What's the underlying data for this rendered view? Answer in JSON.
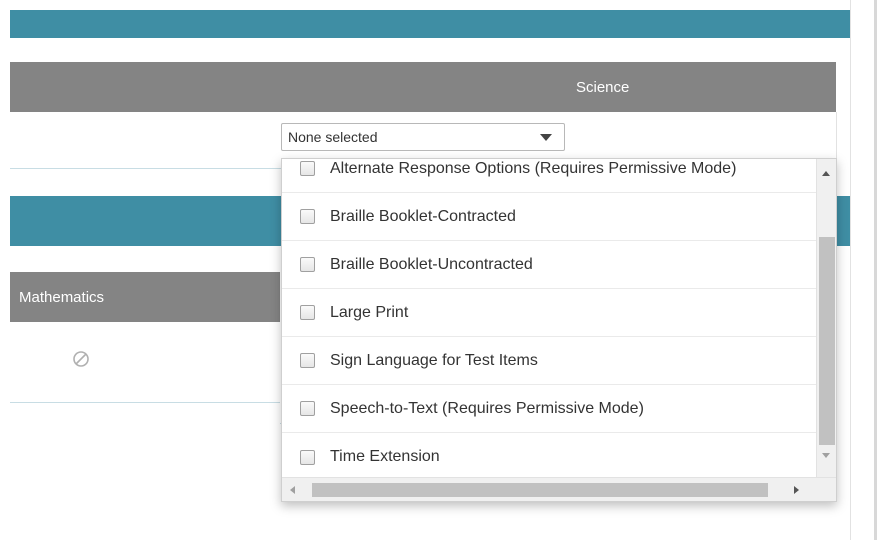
{
  "science": {
    "header": "Science",
    "select_value": "None selected"
  },
  "mathematics": {
    "header": "Mathematics",
    "cell_icon": "not-available-icon"
  },
  "dropdown": {
    "options": [
      "Alternate Response Options (Requires Permissive Mode)",
      "Braille Booklet-Contracted",
      "Braille Booklet-Uncontracted",
      "Large Print",
      "Sign Language for Test Items",
      "Speech-to-Text (Requires Permissive Mode)",
      "Time Extension"
    ]
  },
  "colors": {
    "teal": "#3f8ea4",
    "header_gray": "#848484"
  }
}
